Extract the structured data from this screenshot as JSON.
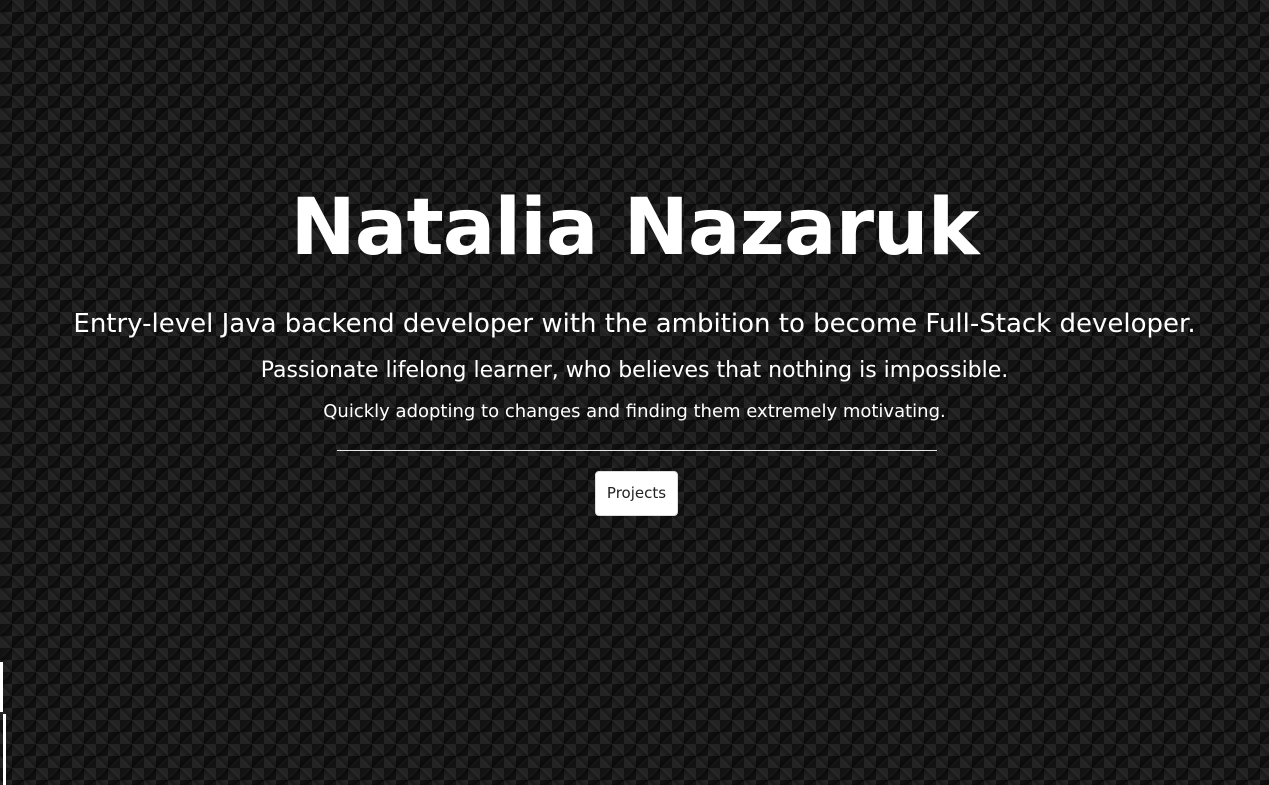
{
  "hero": {
    "name": "Natalia Nazaruk",
    "tagline_primary": "Entry-level Java backend developer with the ambition to become Full-Stack developer.",
    "tagline_secondary": "Passionate lifelong learner, who believes that nothing is impossible.",
    "tagline_tertiary": "Quickly adopting to changes and finding them extremely motivating.",
    "projects_button_label": "Projects"
  },
  "colors": {
    "background": "#141414",
    "text": "#ffffff",
    "button_background": "#ffffff",
    "button_text": "#222222"
  }
}
